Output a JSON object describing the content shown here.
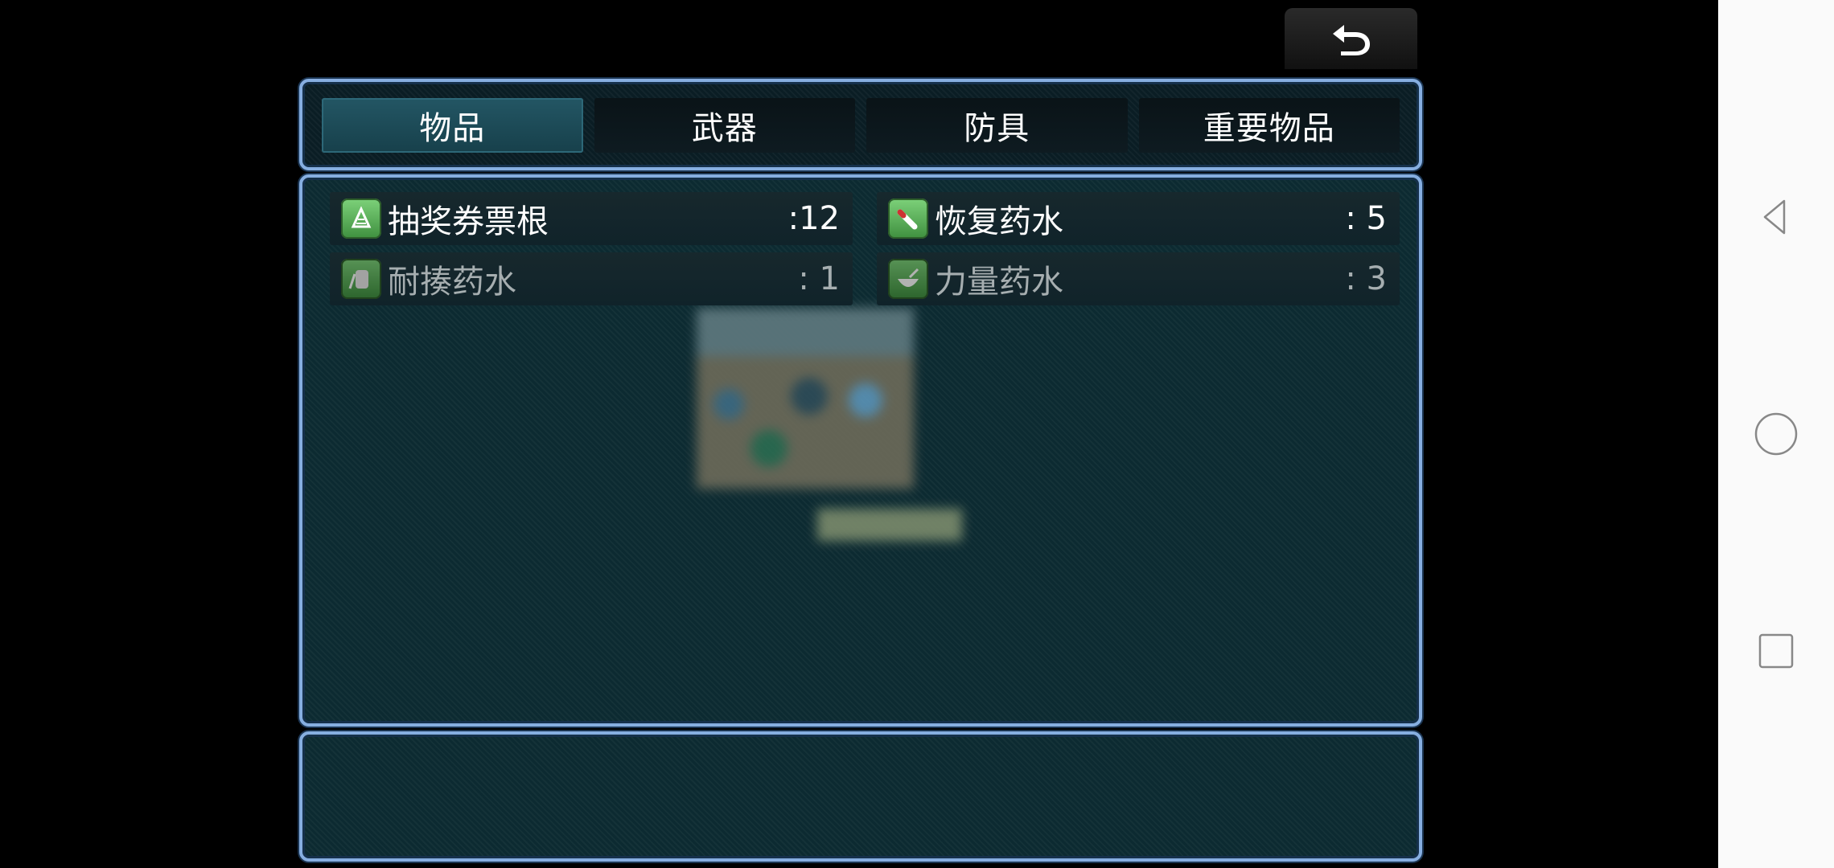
{
  "tabs": [
    {
      "label": "物品",
      "active": true
    },
    {
      "label": "武器",
      "active": false
    },
    {
      "label": "防具",
      "active": false
    },
    {
      "label": "重要物品",
      "active": false
    }
  ],
  "items": [
    {
      "name": "抽奖券票根",
      "count": ":12",
      "icon": "ticket-icon",
      "dimmed": false
    },
    {
      "name": "恢复药水",
      "count": ":  5",
      "icon": "potion-icon",
      "dimmed": false
    },
    {
      "name": "耐揍药水",
      "count": ":  1",
      "icon": "bottle-icon",
      "dimmed": true
    },
    {
      "name": "力量药水",
      "count": ":  3",
      "icon": "bowl-icon",
      "dimmed": true
    }
  ],
  "description": "",
  "colors": {
    "frame": "#86aee0",
    "panel_bg": "#0c2a31",
    "active_tab": "#235664",
    "icon_green": "#5fb35c"
  },
  "nav": {
    "back": "back-triangle-icon",
    "home": "home-circle-icon",
    "recents": "recents-square-icon"
  }
}
